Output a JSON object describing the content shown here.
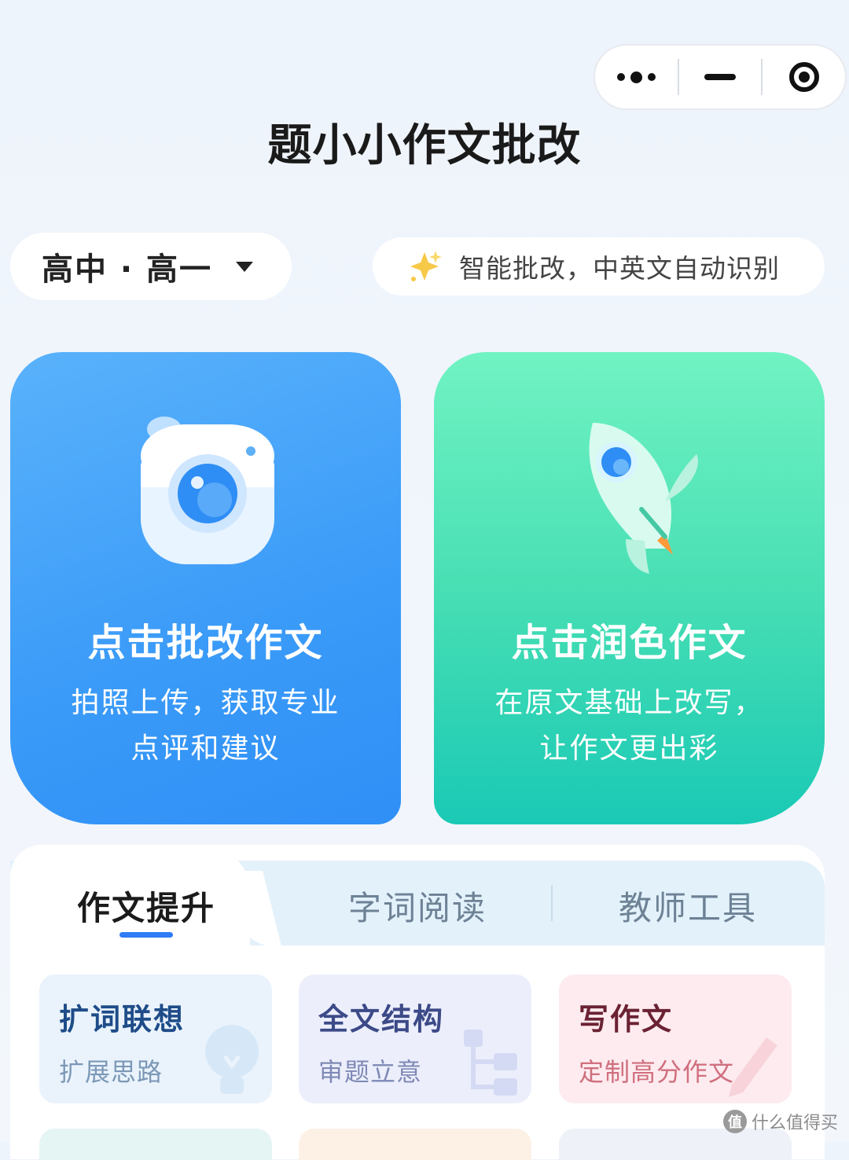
{
  "header": {
    "title": "题小小作文批改"
  },
  "capsule": {
    "more_icon": "more-dots-icon",
    "minimize_icon": "minimize-icon",
    "close_icon": "target-close-icon"
  },
  "grade_select": {
    "value": "高中 · 高一",
    "icon": "caret-down-icon"
  },
  "tip": {
    "text": "智能批改，中英文自动识别",
    "icon": "sparkle-icon"
  },
  "cards": [
    {
      "title": "点击批改作文",
      "desc": "拍照上传，获取专业点评和建议",
      "icon": "camera-icon",
      "color": "#3c9cf8"
    },
    {
      "title": "点击润色作文",
      "desc": "在原文基础上改写，让作文更出彩",
      "icon": "rocket-icon",
      "color": "#2fd3b5"
    }
  ],
  "tabs": [
    {
      "label": "作文提升",
      "active": true
    },
    {
      "label": "字词阅读",
      "active": false
    },
    {
      "label": "教师工具",
      "active": false
    }
  ],
  "tools": [
    {
      "name": "扩词联想",
      "sub": "扩展思路",
      "icon": "lightbulb-icon"
    },
    {
      "name": "全文结构",
      "sub": "审题立意",
      "icon": "structure-icon"
    },
    {
      "name": "写作文",
      "sub": "定制高分作文",
      "icon": "pen-icon"
    }
  ],
  "watermark": {
    "badge": "值",
    "text": "什么值得买"
  }
}
